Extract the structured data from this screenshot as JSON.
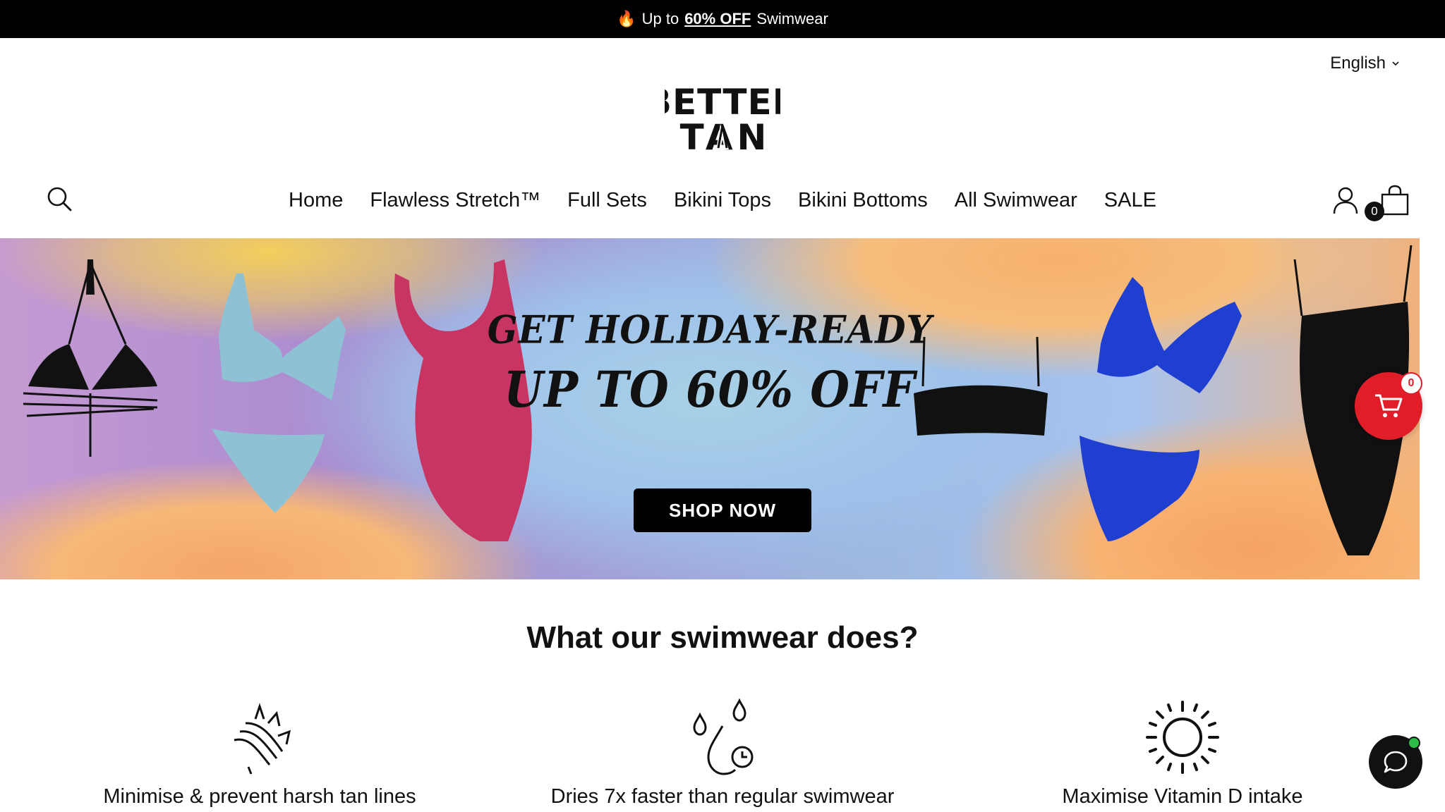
{
  "announcement": {
    "fire_icon": "fire-icon",
    "prefix": "Up to",
    "highlight": "60% OFF",
    "suffix": "Swimwear"
  },
  "language": {
    "label": "English"
  },
  "logo": {
    "line1": "BETTER",
    "line2": "TAN"
  },
  "nav": {
    "items": [
      {
        "label": "Home"
      },
      {
        "label": "Flawless Stretch™"
      },
      {
        "label": "Full Sets"
      },
      {
        "label": "Bikini Tops"
      },
      {
        "label": "Bikini Bottoms"
      },
      {
        "label": "All Swimwear"
      },
      {
        "label": "SALE"
      }
    ]
  },
  "header": {
    "cart_count": "0",
    "icons": [
      "search-icon",
      "account-icon",
      "shopping-bag-icon"
    ]
  },
  "hero": {
    "headline_1": "GET HOLIDAY-READY",
    "headline_2": "UP TO 60% OFF",
    "cta": "SHOP NOW"
  },
  "floating_cart": {
    "count": "0",
    "color": "#e11d2a"
  },
  "section": {
    "title": "What our swimwear does?",
    "features": [
      {
        "icon": "tan-lines-icon",
        "text": "Minimise & prevent harsh tan lines"
      },
      {
        "icon": "water-drops-timer-icon",
        "text": "Dries 7x faster than regular swimwear"
      },
      {
        "icon": "sun-icon",
        "text": "Maximise Vitamin D intake"
      }
    ]
  },
  "chat": {
    "icon": "chat-bubble-icon",
    "status_color": "#2fbd4a"
  }
}
